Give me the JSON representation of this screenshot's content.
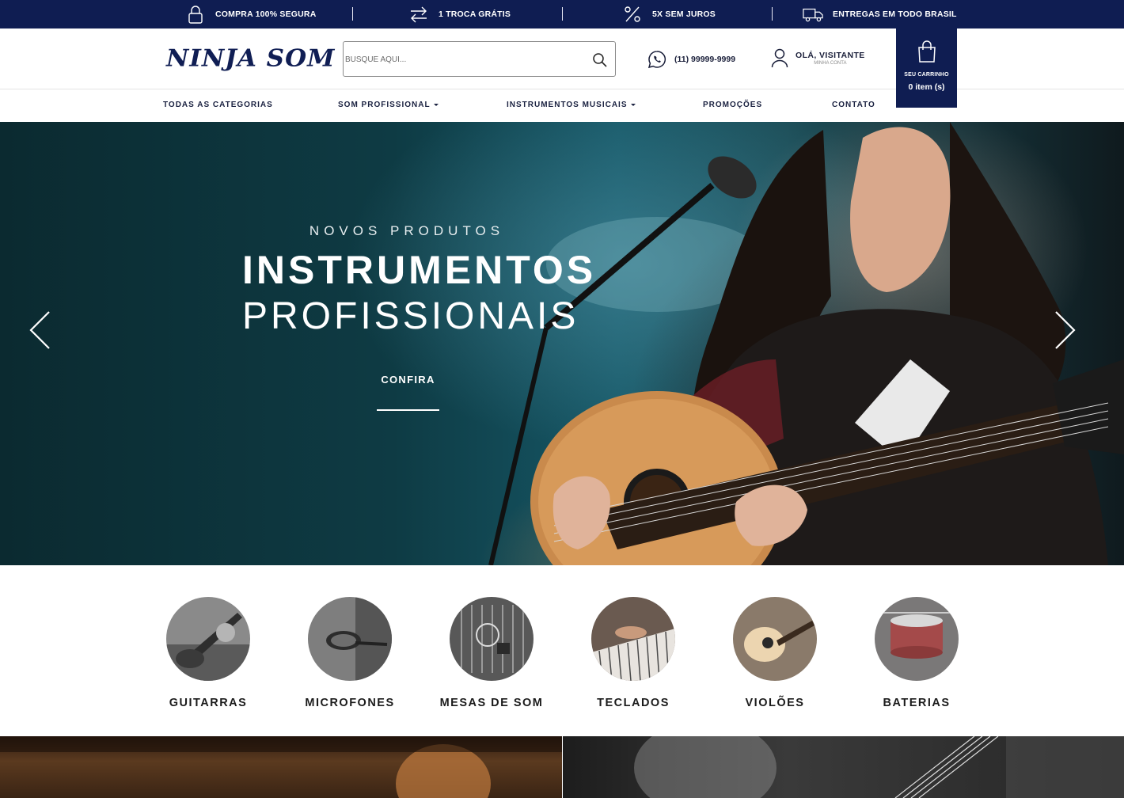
{
  "topbar": {
    "features": [
      {
        "label": "COMPRA 100% SEGURA",
        "icon": "lock-icon"
      },
      {
        "label": "1 TROCA GRÁTIS",
        "icon": "exchange-arrows-icon"
      },
      {
        "label": "5X SEM JUROS",
        "icon": "percent-icon"
      },
      {
        "label": "ENTREGAS EM TODO BRASIL",
        "icon": "truck-icon"
      }
    ]
  },
  "header": {
    "logo": "NINJA SOM",
    "search": {
      "placeholder": "BUSQUE AQUI..."
    },
    "phone": "(11) 99999-9999",
    "account": {
      "greeting": "OLÁ, VISITANTE",
      "sub": "MINHA CONTA"
    },
    "cart": {
      "label": "SEU CARRINHO",
      "count": "0 item (s)"
    }
  },
  "nav": {
    "items": [
      {
        "label": "TODAS AS CATEGORIAS",
        "dropdown": false
      },
      {
        "label": "SOM PROFISSIONAL",
        "dropdown": true
      },
      {
        "label": "INSTRUMENTOS MUSICAIS",
        "dropdown": true
      },
      {
        "label": "PROMOÇÕES",
        "dropdown": false
      },
      {
        "label": "CONTATO",
        "dropdown": false
      }
    ]
  },
  "hero": {
    "kicker": "NOVOS PRODUTOS",
    "title_line1": "INSTRUMENTOS",
    "title_line2": "PROFISSIONAIS",
    "cta": "CONFIRA"
  },
  "categories": [
    {
      "label": "GUITARRAS"
    },
    {
      "label": "MICROFONES"
    },
    {
      "label": "MESAS DE SOM"
    },
    {
      "label": "TECLADOS"
    },
    {
      "label": "VIOLÕES"
    },
    {
      "label": "BATERIAS"
    }
  ],
  "colors": {
    "brand_navy": "#0f1d52",
    "text_dark": "#1a2140",
    "white": "#ffffff"
  }
}
